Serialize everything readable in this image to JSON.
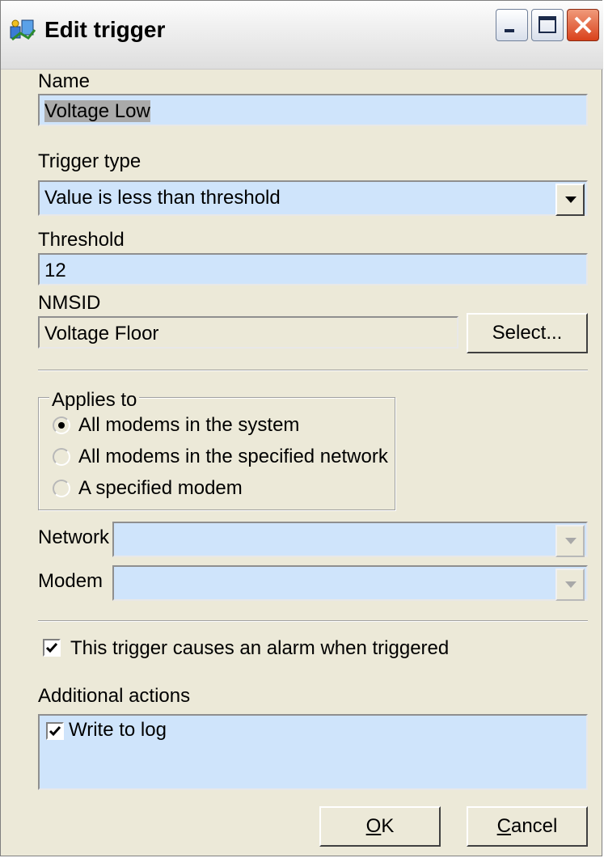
{
  "window": {
    "title": "Edit trigger",
    "icon": "network-app-icon"
  },
  "name_field": {
    "label": "Name",
    "value": "Voltage Low"
  },
  "trigger_type": {
    "label": "Trigger type",
    "selected": "Value is less than threshold"
  },
  "threshold": {
    "label": "Threshold",
    "value": "12"
  },
  "nmsid": {
    "label": "NMSID",
    "value": "Voltage Floor",
    "select_button": "Select..."
  },
  "applies_to": {
    "caption": "Applies to",
    "options": [
      "All modems in the system",
      "All modems in the specified network",
      "A specified modem"
    ],
    "selected_index": 0
  },
  "network": {
    "label": "Network",
    "value": ""
  },
  "modem": {
    "label": "Modem",
    "value": ""
  },
  "alarm_checkbox": {
    "label": "This trigger causes an alarm when triggered",
    "checked": true
  },
  "additional_actions": {
    "label": "Additional actions",
    "items": [
      {
        "label": "Write to log",
        "checked": true
      }
    ]
  },
  "buttons": {
    "ok_accel": "O",
    "ok_rest": "K",
    "cancel_accel": "C",
    "cancel_rest": "ancel"
  },
  "colors": {
    "field_bg": "#cfe4fb",
    "dialog_bg": "#ece9d8",
    "close_button": "#d9411b"
  }
}
